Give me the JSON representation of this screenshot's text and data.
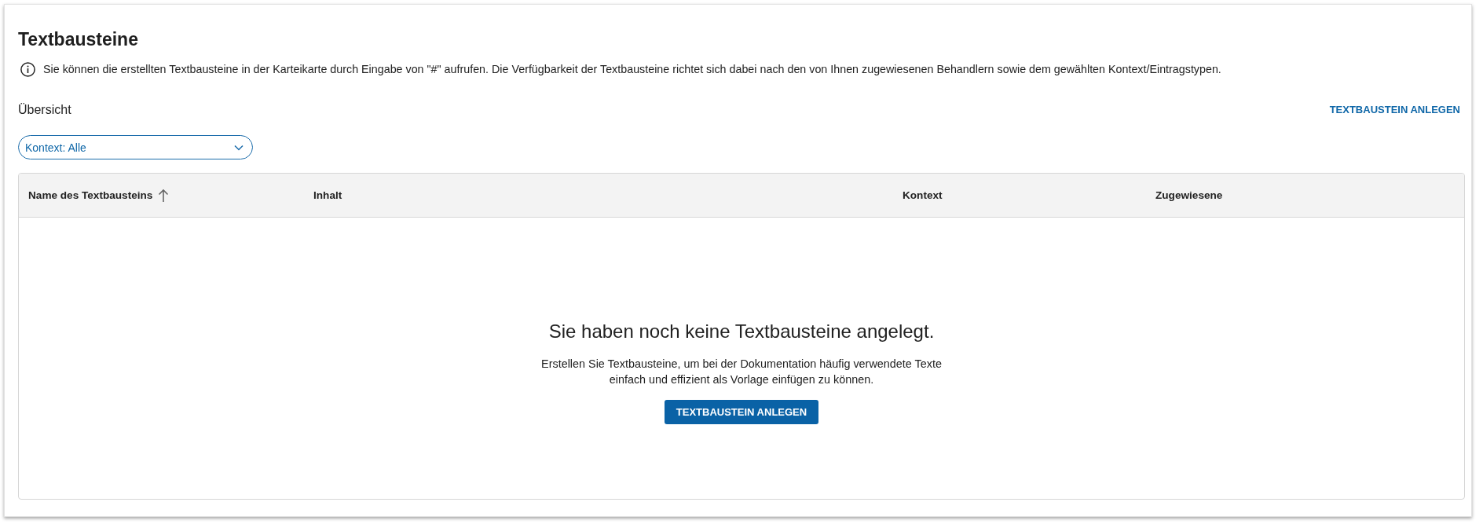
{
  "page": {
    "title": "Textbausteine",
    "info": "Sie können die erstellten Textbausteine in der Karteikarte durch Eingabe von \"#\" aufrufen. Die Verfügbarkeit der Textbausteine richtet sich dabei nach den von Ihnen zugewiesenen Behandlern sowie dem gewählten Kontext/Eintragstypen."
  },
  "overview": {
    "label": "Übersicht",
    "create_link": "TEXTBAUSTEIN ANLEGEN"
  },
  "filter": {
    "value": "Kontext: Alle"
  },
  "table": {
    "columns": [
      {
        "label": "Name des Textbausteins",
        "sorted": true
      },
      {
        "label": "Inhalt",
        "sorted": false
      },
      {
        "label": "Kontext",
        "sorted": false
      },
      {
        "label": "Zugewiesene",
        "sorted": false
      }
    ]
  },
  "empty_state": {
    "heading": "Sie haben noch keine Textbausteine angelegt.",
    "text": "Erstellen Sie Textbausteine, um bei der Dokumentation häufig verwendete Texte\neinfach und effizient als Vorlage einfügen zu können.",
    "button": "TEXTBAUSTEIN ANLEGEN"
  }
}
